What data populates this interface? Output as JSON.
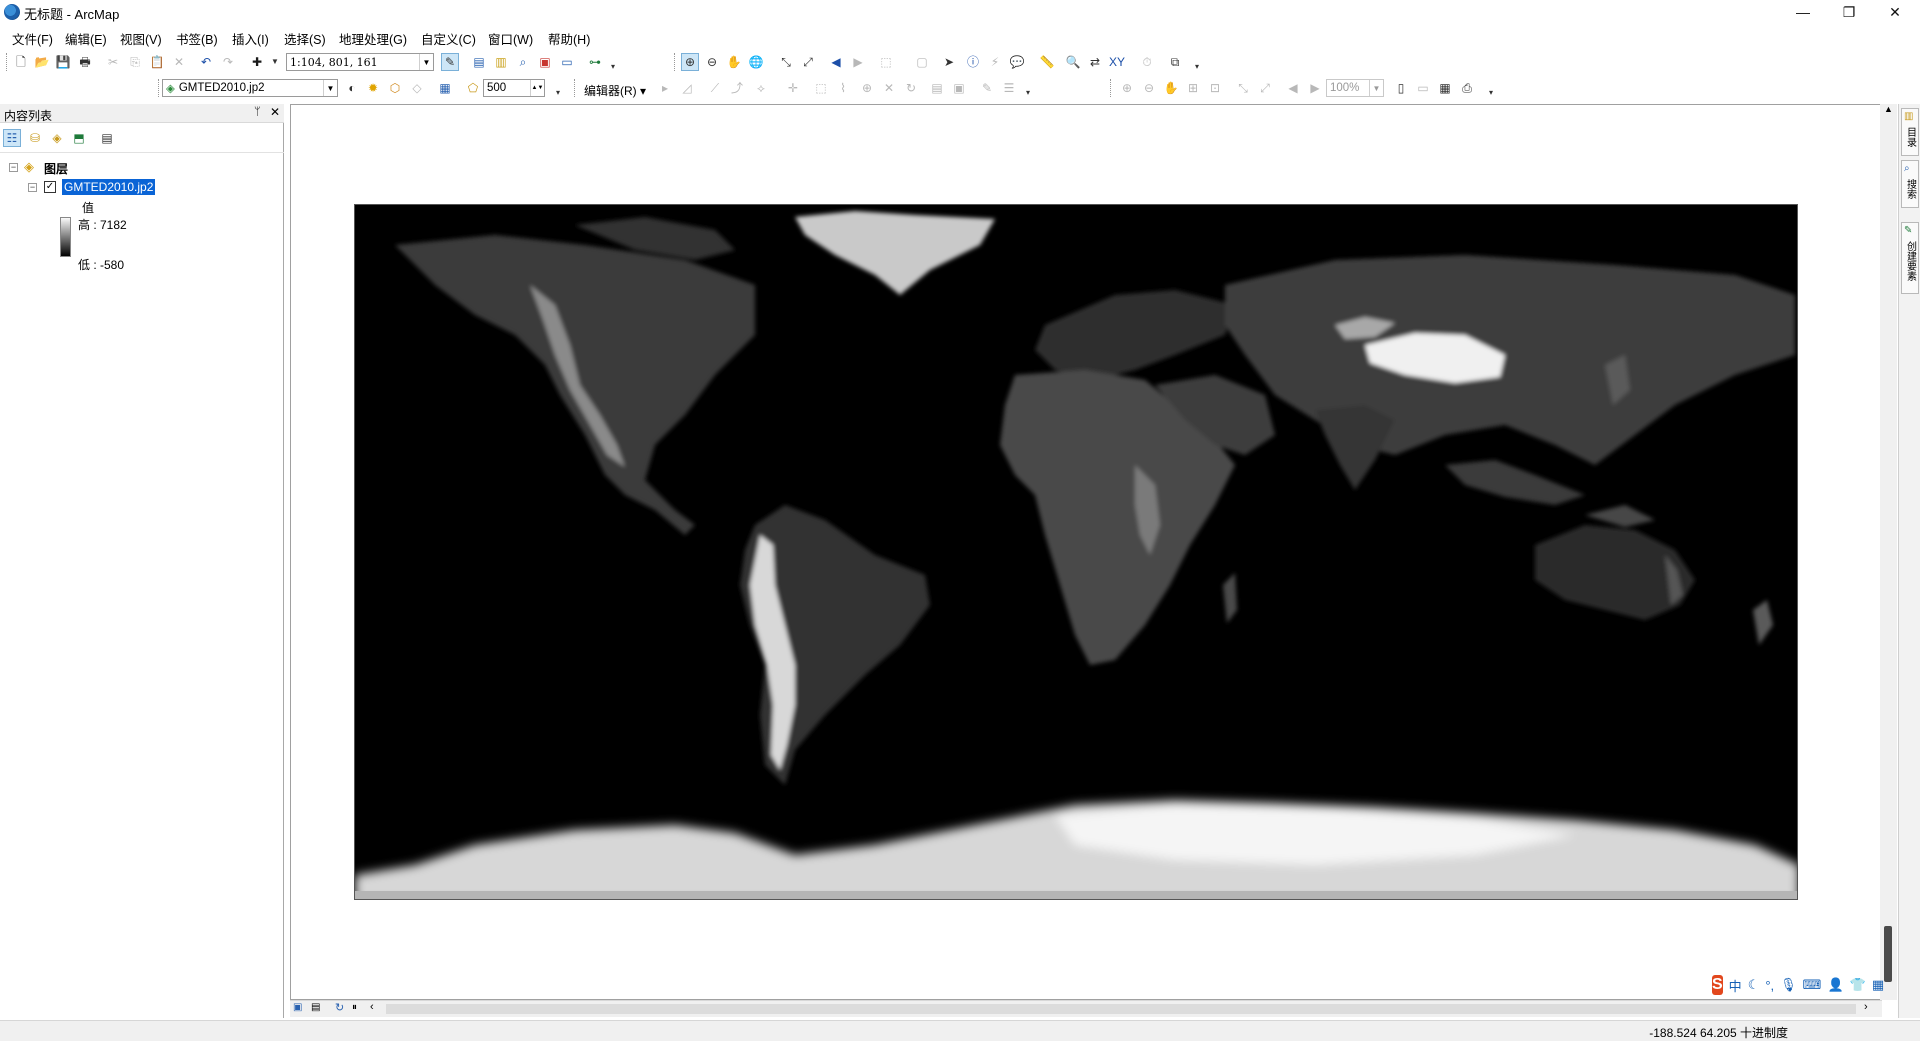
{
  "window": {
    "title": "无标题 - ArcMap",
    "minimize_icon": "minimize-icon",
    "restore_icon": "restore-icon",
    "close_icon": "close-icon"
  },
  "menubar": {
    "items": [
      "文件(F)",
      "编辑(E)",
      "视图(V)",
      "书签(B)",
      "插入(I)",
      "选择(S)",
      "地理处理(G)",
      "自定义(C)",
      "窗口(W)",
      "帮助(H)"
    ]
  },
  "toolbar": {
    "scale_value": "1:104, 801, 161",
    "layer_combo_value": "GMTED2010.jp2",
    "resolution_value": "500",
    "editor_label": "编辑器(R)",
    "zoom_percent": "100%"
  },
  "toc": {
    "title": "内容列表",
    "group_label": "图层",
    "layer_name": "GMTED2010.jp2",
    "legend_header": "值",
    "legend_high": "高 : 7182",
    "legend_low": "低 : -580"
  },
  "dock": {
    "tab1": "目录",
    "tab2": "搜索",
    "tab3": "创建要素"
  },
  "status": {
    "coordinates": "-188.524  64.205 十进制度"
  },
  "ime": {
    "logo": "S",
    "mode": "中"
  },
  "colors": {
    "selection": "#0a64d6",
    "map_background": "#000000"
  }
}
